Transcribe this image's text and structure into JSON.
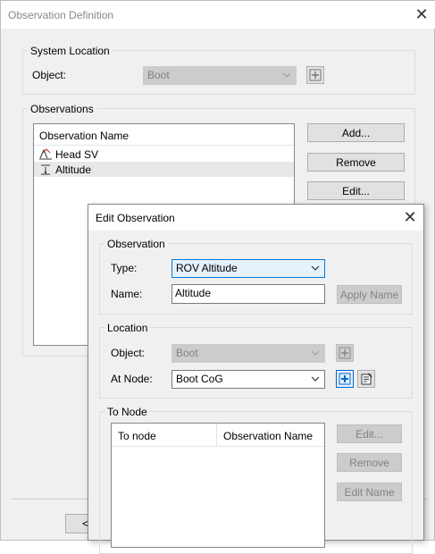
{
  "main_window": {
    "title": "Observation Definition",
    "system_location": {
      "group_label": "System Location",
      "object_label": "Object:",
      "object_value": "Boot"
    },
    "observations": {
      "group_label": "Observations",
      "column_header": "Observation Name",
      "items": [
        {
          "name": "Head SV",
          "icon": "heading-sv-icon"
        },
        {
          "name": "Altitude",
          "icon": "altitude-icon"
        }
      ],
      "add_label": "Add...",
      "remove_label": "Remove",
      "edit_label": "Edit..."
    },
    "bottom_button_partial": "<"
  },
  "edit_dialog": {
    "title": "Edit Observation",
    "observation": {
      "group_label": "Observation",
      "type_label": "Type:",
      "type_value": "ROV Altitude",
      "name_label": "Name:",
      "name_value": "Altitude",
      "apply_name_label": "Apply Name"
    },
    "location": {
      "group_label": "Location",
      "object_label": "Object:",
      "object_value": "Boot",
      "at_node_label": "At Node:",
      "at_node_value": "Boot CoG"
    },
    "to_node": {
      "group_label": "To Node",
      "columns": [
        "To node",
        "Observation Name"
      ],
      "edit_label": "Edit...",
      "remove_label": "Remove",
      "edit_name_label": "Edit Name"
    }
  },
  "colors": {
    "dialog_bg": "#f0f0f0",
    "selected_combo_bg": "#e5f1fb",
    "selected_combo_border": "#0078d7",
    "disabled_text": "#838383",
    "add_icon_blue": "#0066cc"
  }
}
